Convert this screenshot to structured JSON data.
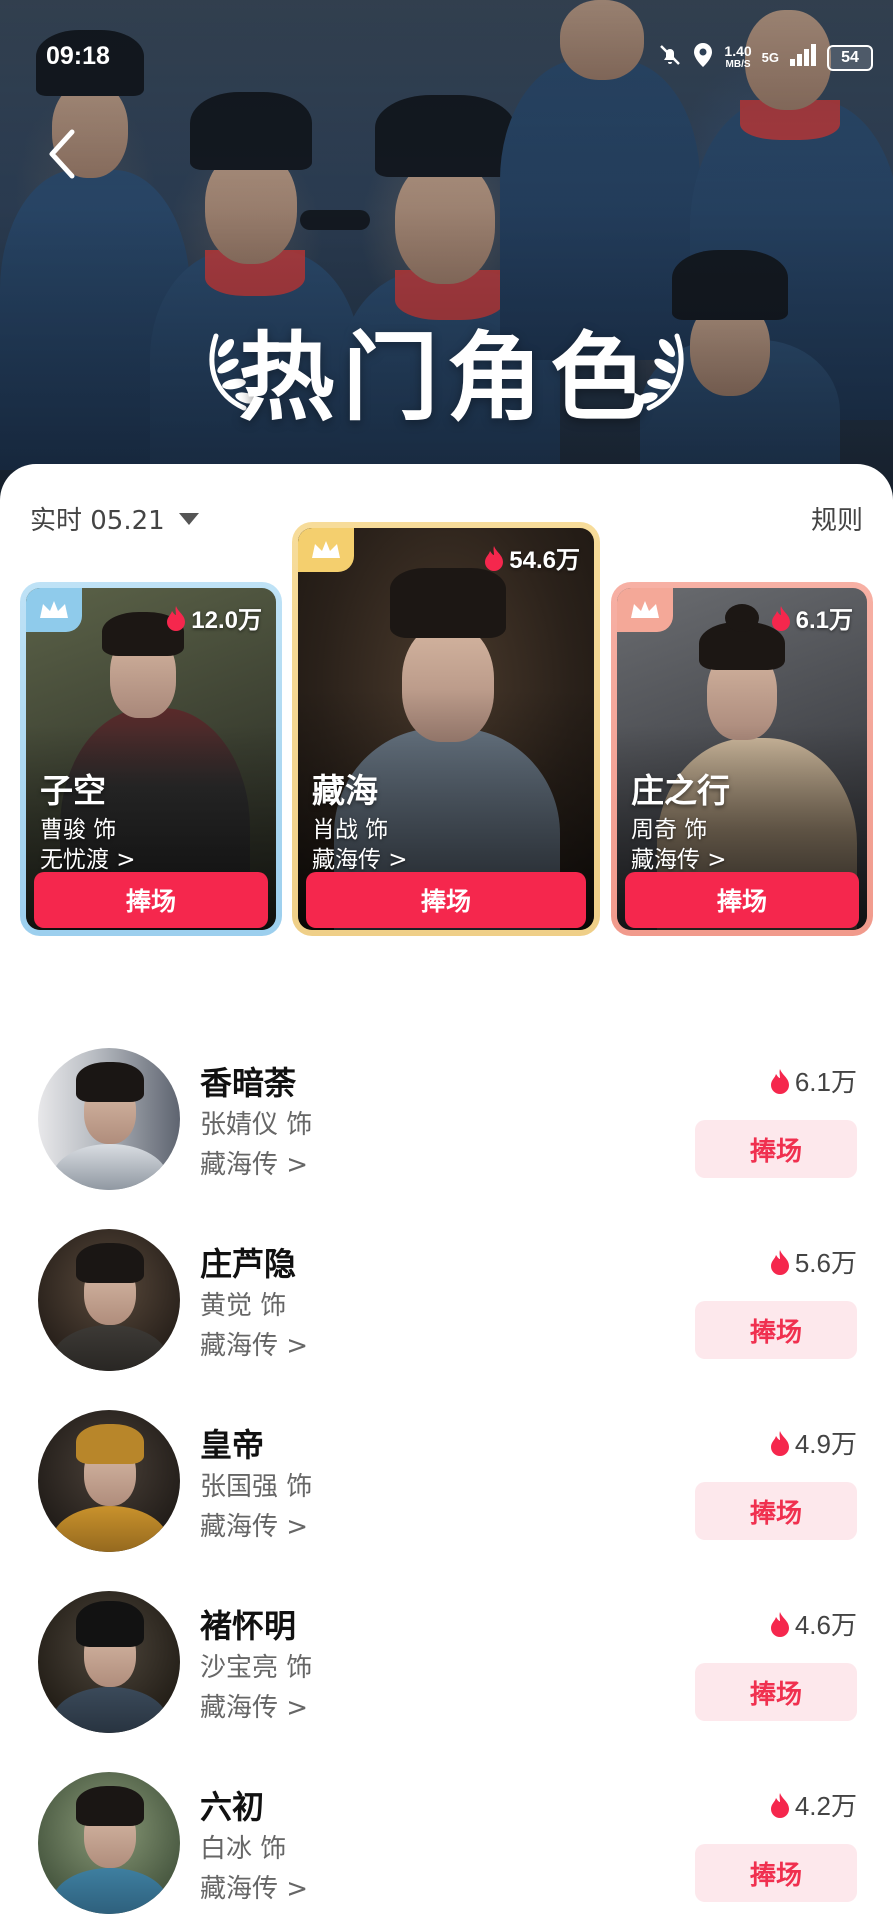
{
  "status_bar": {
    "time": "09:18",
    "network_speed": "1.40",
    "network_unit": "MB/S",
    "signal": "5G",
    "battery": "54"
  },
  "header": {
    "title": "热门角色"
  },
  "filter": {
    "date_label": "实时 05.21",
    "rules_label": "规则"
  },
  "colors": {
    "accent": "#f5274d",
    "accent_light": "#fde8ec",
    "gold": "#efcf88",
    "blue": "#9ccfee",
    "pink": "#f19a8c"
  },
  "top_cards": [
    {
      "rank_style": "blue",
      "heat": "12.0万",
      "name": "子空",
      "actor": "曹骏 饰",
      "show": "无忧渡 >",
      "button": "捧场"
    },
    {
      "rank_style": "gold",
      "heat": "54.6万",
      "name": "藏海",
      "actor": "肖战 饰",
      "show": "藏海传 >",
      "button": "捧场"
    },
    {
      "rank_style": "pink",
      "heat": "6.1万",
      "name": "庄之行",
      "actor": "周奇 饰",
      "show": "藏海传 >",
      "button": "捧场"
    }
  ],
  "list": [
    {
      "name": "香暗荼",
      "actor": "张婧仪 饰",
      "show": "藏海传 >",
      "heat": "6.1万",
      "button": "捧场"
    },
    {
      "name": "庄芦隐",
      "actor": "黄觉 饰",
      "show": "藏海传 >",
      "heat": "5.6万",
      "button": "捧场"
    },
    {
      "name": "皇帝",
      "actor": "张国强 饰",
      "show": "藏海传 >",
      "heat": "4.9万",
      "button": "捧场"
    },
    {
      "name": "褚怀明",
      "actor": "沙宝亮 饰",
      "show": "藏海传 >",
      "heat": "4.6万",
      "button": "捧场"
    },
    {
      "name": "六初",
      "actor": "白冰 饰",
      "show": "藏海传 >",
      "heat": "4.2万",
      "button": "捧场"
    }
  ]
}
